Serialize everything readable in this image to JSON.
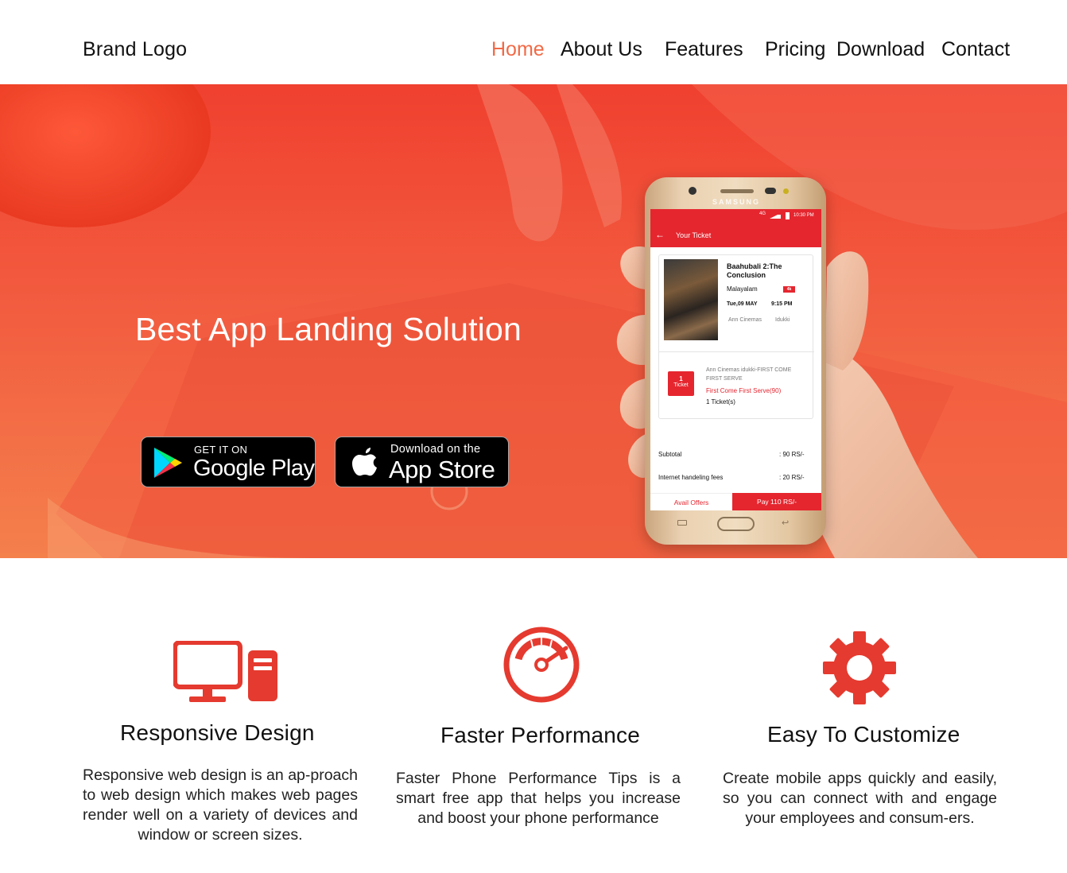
{
  "header": {
    "brand": "Brand Logo",
    "nav": [
      {
        "label": "Home",
        "active": true
      },
      {
        "label": "About Us",
        "active": false
      },
      {
        "label": "Features",
        "active": false
      },
      {
        "label": "Pricing",
        "active": false
      },
      {
        "label": "Download",
        "active": false
      },
      {
        "label": "Contact",
        "active": false
      }
    ]
  },
  "hero": {
    "title": "Best App Landing Solution",
    "google_play": {
      "small": "GET IT ON",
      "big": "Google Play"
    },
    "app_store": {
      "small": "Download on the",
      "big": "App Store"
    },
    "phone": {
      "brand": "SAMSUNG",
      "status_time": "10:30 PM",
      "status_network": "4G",
      "screen_title": "Your Ticket",
      "movie_title_1": "Baahubali 2:The",
      "movie_title_2": "Conclusion",
      "language": "Malayalam",
      "format": "4k",
      "date": "Tue,09 MAY",
      "time": "9:15 PM",
      "cinema": "Ann Cinemas",
      "city": "Idukki",
      "ticket_count_num": "1",
      "ticket_count_label": "Ticket",
      "booking_line_1": "Ann Cinemas idukki-FIRST COME",
      "booking_line_2": "FIRST SERVE",
      "booking_class": "First Come First Serve(90)",
      "booking_qty": "1 Ticket(s)",
      "subtotal_label": "Subtotal",
      "subtotal_value": ": 90 RS/-",
      "fees_label": "Internet handeling fees",
      "fees_value": ": 20 RS/-",
      "avail_offers": "Avail Offers",
      "pay": "Pay 110 RS/-"
    }
  },
  "features": [
    {
      "icon": "desktop-computer-icon",
      "title": "Responsive Design",
      "desc": "Responsive web design is an ap-proach to web design which makes web pages render well on a variety of devices and window or screen sizes."
    },
    {
      "icon": "speedometer-icon",
      "title": "Faster Performance",
      "desc": "Faster Phone Performance Tips is a smart free app that helps you increase and boost your phone performance"
    },
    {
      "icon": "gear-icon",
      "title": "Easy To Customize",
      "desc": "Create mobile apps quickly and easily, so you can connect with and engage your employees and consum-ers."
    }
  ],
  "colors": {
    "accent": "#f26a46",
    "icon_red": "#e53a2f",
    "hero_top": "#f0402f",
    "hero_bottom": "#f4804c"
  }
}
